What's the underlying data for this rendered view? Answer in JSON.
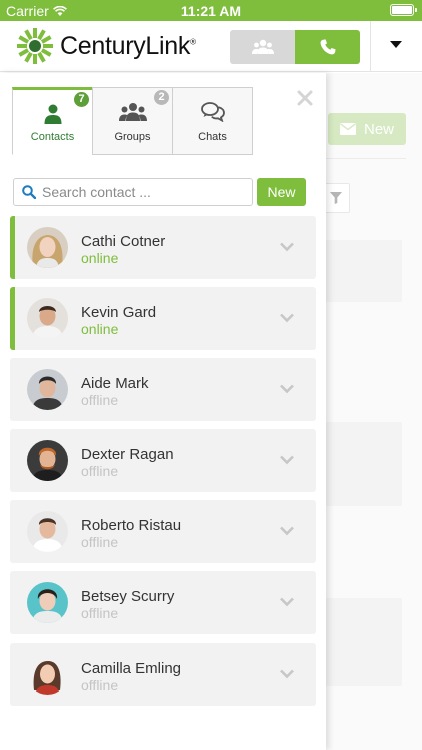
{
  "status_bar": {
    "carrier": "Carrier",
    "time": "11:21 AM"
  },
  "header": {
    "logo_text": "CenturyLink",
    "logo_mark": "®"
  },
  "background": {
    "new_label": "New"
  },
  "colors": {
    "accent": "#7fbd3d",
    "online": "#7fbd3d",
    "offline": "#c4c4c4"
  },
  "tabs": [
    {
      "label": "Contacts",
      "badge": "7",
      "icon": "person-icon",
      "active": true
    },
    {
      "label": "Groups",
      "badge": "2",
      "icon": "group-icon",
      "active": false
    },
    {
      "label": "Chats",
      "badge": "",
      "icon": "chat-bubbles-icon",
      "active": false
    }
  ],
  "search": {
    "placeholder": "Search contact ...",
    "value": ""
  },
  "new_button": "New",
  "contacts": [
    {
      "name": "Cathi Cotner",
      "status": "online"
    },
    {
      "name": "Kevin Gard",
      "status": "online"
    },
    {
      "name": "Aide Mark",
      "status": "offline"
    },
    {
      "name": "Dexter Ragan",
      "status": "offline"
    },
    {
      "name": "Roberto Ristau",
      "status": "offline"
    },
    {
      "name": "Betsey Scurry",
      "status": "offline"
    },
    {
      "name": "Camilla Emling",
      "status": "offline"
    }
  ]
}
